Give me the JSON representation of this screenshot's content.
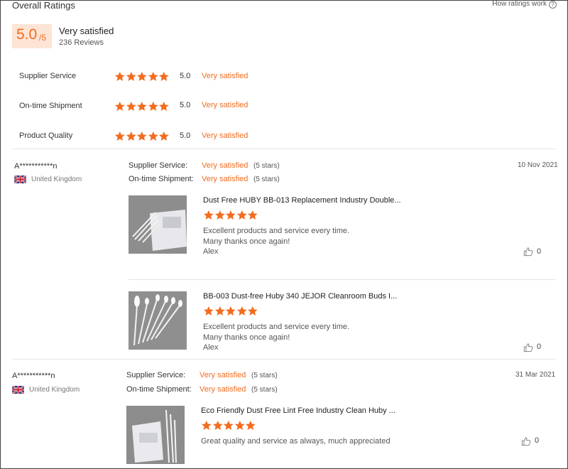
{
  "header": {
    "title": "Overall Ratings",
    "how_link": "How ratings work",
    "help_icon": "?"
  },
  "summary": {
    "score": "5.0",
    "score_max": "/5",
    "label": "Very satisfied",
    "reviews": "236 Reviews"
  },
  "dimensions": [
    {
      "name": "Supplier Service",
      "stars": 5,
      "value": "5.0",
      "label": "Very satisfied"
    },
    {
      "name": "On-time Shipment",
      "stars": 5,
      "value": "5.0",
      "label": "Very satisfied"
    },
    {
      "name": "Product Quality",
      "stars": 5,
      "value": "5.0",
      "label": "Very satisfied"
    }
  ],
  "reviews": [
    {
      "user": "A***********n",
      "country": "United Kingdom",
      "date": "10 Nov 2021",
      "supplier_label": "Supplier Service:",
      "supplier_value": "Very satisfied",
      "supplier_stars": "(5 stars)",
      "shipment_label": "On-time Shipment:",
      "shipment_value": "Very satisfied",
      "shipment_stars": "(5 stars)",
      "products": [
        {
          "title": "Dust Free HUBY BB-013 Replacement Industry Double...",
          "stars": 5,
          "lines": [
            "Excellent products and service every time.",
            "Many thanks once again!",
            "Alex"
          ],
          "likes": "0"
        },
        {
          "title": "BB-003 Dust-free Huby 340 JEJOR Cleanroom Buds I...",
          "stars": 5,
          "lines": [
            "Excellent products and service every time.",
            "Many thanks once again!",
            "Alex"
          ],
          "likes": "0"
        }
      ]
    },
    {
      "user": "A***********n",
      "country": "United Kingdom",
      "date": "31 Mar 2021",
      "supplier_label": "Supplier Service:",
      "supplier_value": "Very satisfied",
      "supplier_stars": "(5 stars)",
      "shipment_label": "On-time Shipment:",
      "shipment_value": "Very satisfied",
      "shipment_stars": "(5 stars)",
      "products": [
        {
          "title": "Eco Friendly Dust Free Lint Free Industry Clean Huby ...",
          "stars": 5,
          "lines": [
            "Great quality and service as always, much appreciated"
          ],
          "likes": "0"
        }
      ]
    }
  ],
  "colors": {
    "accent": "#f36c1f",
    "score_bg": "#fde4d5"
  },
  "icons": [
    "star-icon",
    "uk-flag-icon",
    "thumbs-up-icon",
    "help-icon"
  ]
}
